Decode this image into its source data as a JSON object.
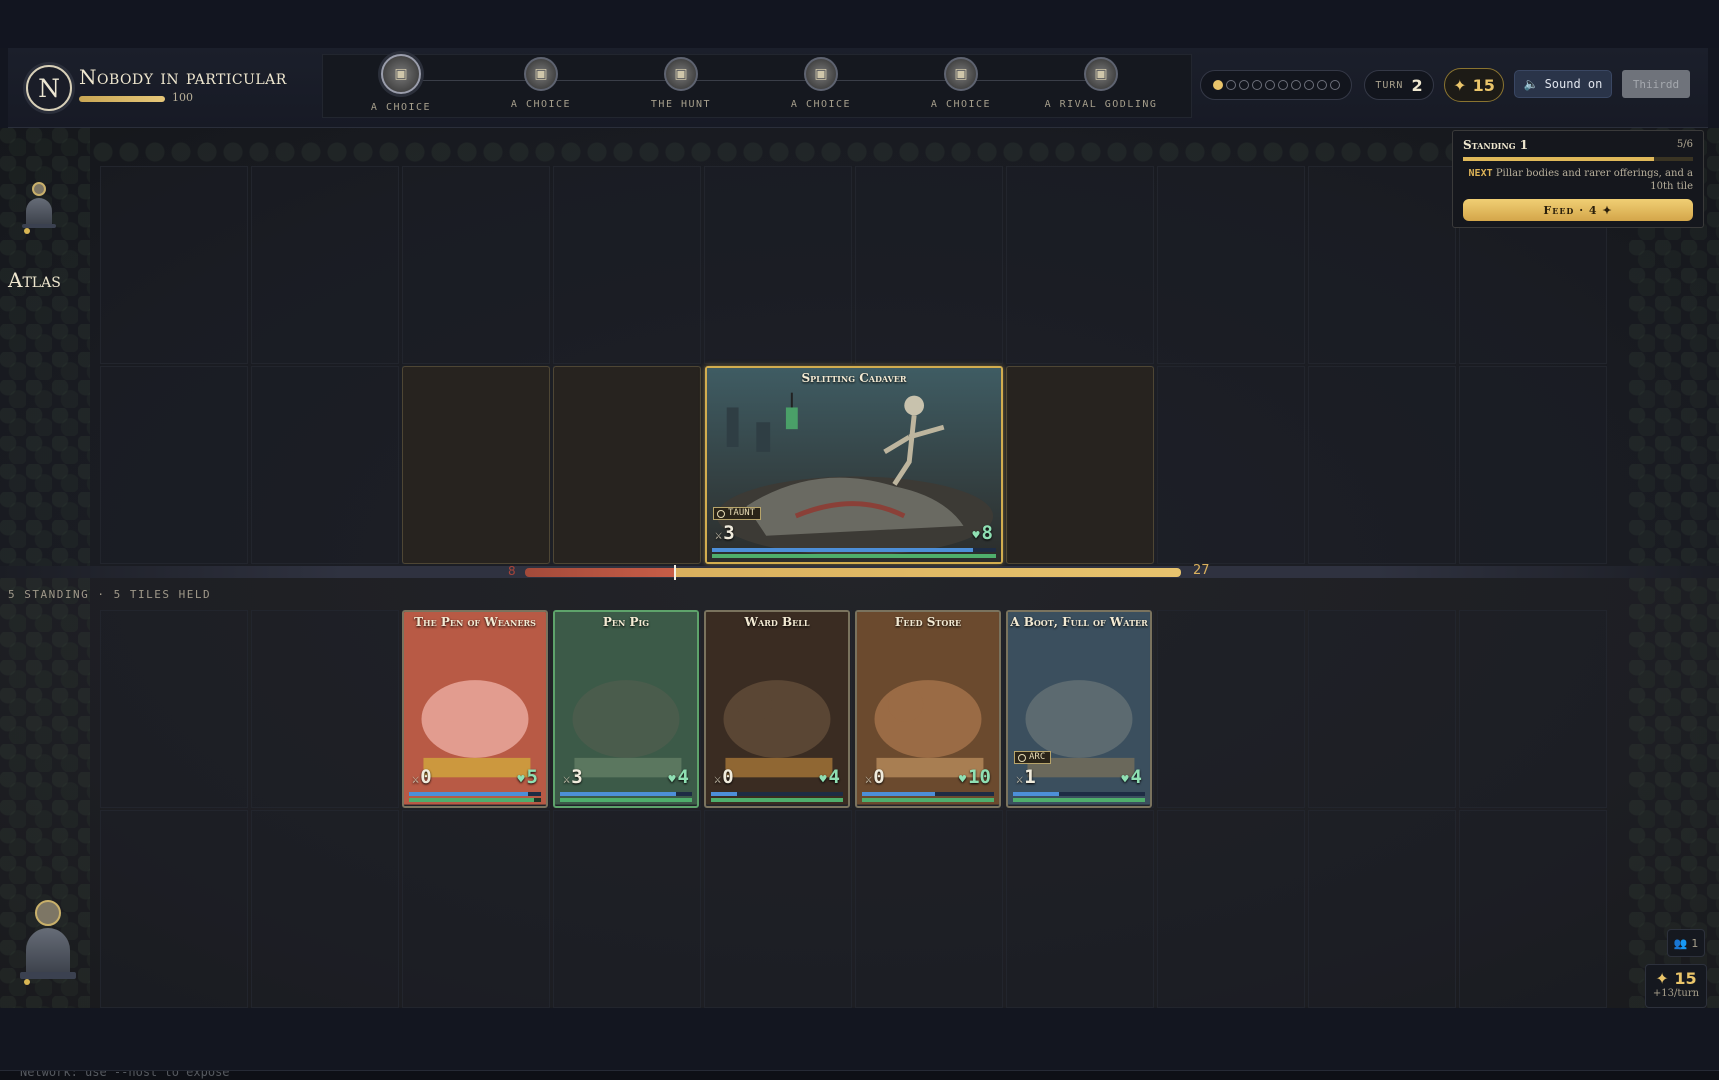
{
  "player": {
    "initial": "N",
    "name": "Nobody in particular",
    "hp": 100,
    "hp_fraction": 1.0
  },
  "path_nodes": [
    {
      "label": "A CHOICE",
      "current": true
    },
    {
      "label": "A CHOICE",
      "current": false
    },
    {
      "label": "THE HUNT",
      "current": false
    },
    {
      "label": "A CHOICE",
      "current": false
    },
    {
      "label": "A CHOICE",
      "current": false
    },
    {
      "label": "A RIVAL GODLING",
      "current": false
    }
  ],
  "progress_pips": {
    "filled": 1,
    "total": 10
  },
  "turn": {
    "label": "TURN",
    "value": "2"
  },
  "gold": {
    "icon": "sparkle-icon",
    "value": "15"
  },
  "sound_label": "Sound on",
  "third_button_label": "Thiirdd",
  "opponent": {
    "name": "Atlas"
  },
  "standing_panel": {
    "title": "Standing",
    "level": "1",
    "count": "5/6",
    "progress_fraction": 0.83,
    "next_key": "NEXT",
    "next_text": "Pillar bodies and rarer offerings, and a 10th tile",
    "feed_label": "Feed · 4 ✦"
  },
  "enemy_cards": [
    {
      "name": "Splitting Cadaver",
      "attack": "3",
      "health": "8",
      "keyword": "TAUNT",
      "blue": 0.92,
      "green": 1.0
    }
  ],
  "health_track": {
    "min": "8",
    "max": "27",
    "marker_fraction": 0.22
  },
  "standing_summary": "5 STANDING · 5 TILES HELD",
  "player_cards": [
    {
      "name": "The Pen of Weaners",
      "attack": "0",
      "health": "5",
      "keyword": "",
      "blue": 0.9,
      "green": 0.95
    },
    {
      "name": "Pen Pig",
      "attack": "3",
      "health": "4",
      "keyword": "",
      "blue": 0.88,
      "green": 1.0
    },
    {
      "name": "Ward Bell",
      "attack": "0",
      "health": "4",
      "keyword": "",
      "blue": 0.2,
      "green": 1.0
    },
    {
      "name": "Feed Store",
      "attack": "0",
      "health": "10",
      "keyword": "",
      "blue": 0.55,
      "green": 1.0
    },
    {
      "name": "A Boot, Full of Water",
      "attack": "1",
      "health": "4",
      "keyword": "ARC",
      "blue": 0.35,
      "green": 1.0
    }
  ],
  "mini_stats": {
    "units": "1",
    "gold": "15",
    "rate": "+13/turn"
  },
  "terminal_text": "Network: use --host to expose",
  "colors": {
    "gold": "#e9c46a",
    "hp_red": "#c75d47",
    "hp_gold": "#e7c36e",
    "health_green": "#8fe0b3"
  }
}
